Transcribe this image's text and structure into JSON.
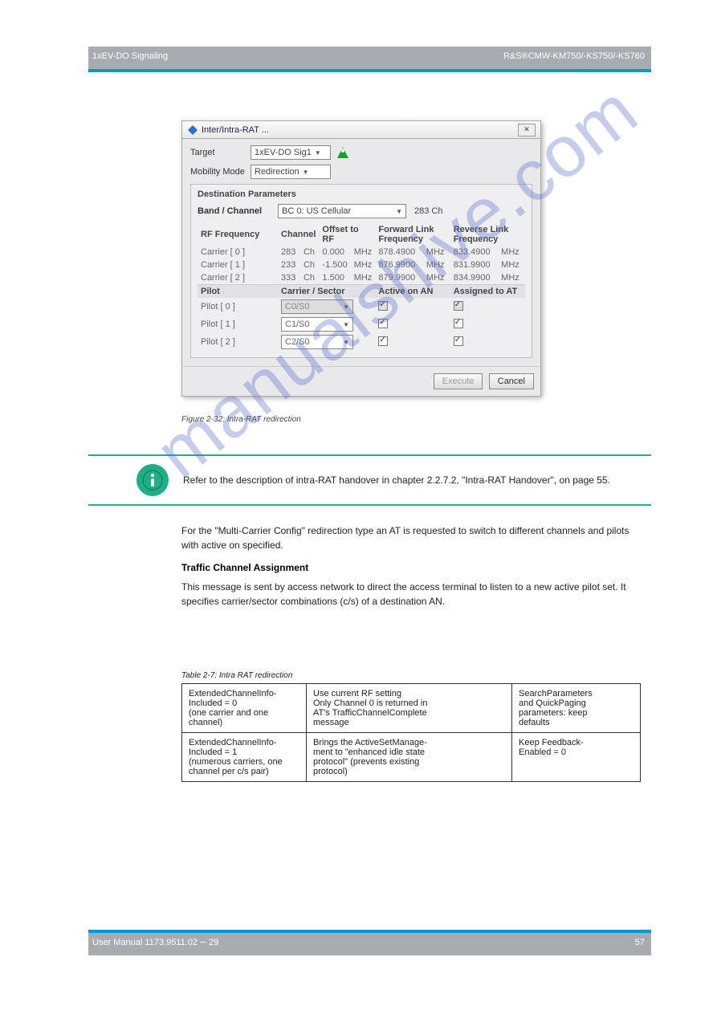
{
  "header": {
    "left": "1xEV-DO Signaling",
    "right": "R&S®CMW-KM750/-KS750/-KS760"
  },
  "dialog": {
    "title": "Inter/Intra-RAT ...",
    "target_label": "Target",
    "target_value": "1xEV-DO Sig1",
    "mobility_label": "Mobility Mode",
    "mobility_value": "Redirection",
    "group_title": "Destination Parameters",
    "band_label": "Band / Channel",
    "band_value": "BC 0: US Cellular",
    "band_ch": "283 Ch",
    "rf_label": "RF Frequency",
    "headers": {
      "ch": "Channel",
      "off": "Offset to RF",
      "fwd": "Forward Link Frequency",
      "rev": "Reverse Link Frequency"
    },
    "carriers": [
      {
        "name": "Carrier [ 0 ]",
        "ch": "283",
        "chu": "Ch",
        "off": "0.000",
        "offu": "MHz",
        "fwd": "878.4900",
        "fwdu": "MHz",
        "rev": "833.4900",
        "revu": "MHz"
      },
      {
        "name": "Carrier [ 1 ]",
        "ch": "233",
        "chu": "Ch",
        "off": "-1.500",
        "offu": "MHz",
        "fwd": "876.9900",
        "fwdu": "MHz",
        "rev": "831.9900",
        "revu": "MHz"
      },
      {
        "name": "Carrier [ 2 ]",
        "ch": "333",
        "chu": "Ch",
        "off": "1.500",
        "offu": "MHz",
        "fwd": "879.9900",
        "fwdu": "MHz",
        "rev": "834.9900",
        "revu": "MHz"
      }
    ],
    "pilot_label": "Pilot",
    "pilot_headers": {
      "cs": "Carrier / Sector",
      "act": "Active on AN",
      "asg": "Assigned to AT"
    },
    "pilots": [
      {
        "name": "Pilot [ 0 ]",
        "cs": "C0/S0"
      },
      {
        "name": "Pilot [ 1 ]",
        "cs": "C1/S0"
      },
      {
        "name": "Pilot [ 2 ]",
        "cs": "C2/S0"
      }
    ],
    "buttons": {
      "exec": "Execute",
      "cancel": "Cancel"
    }
  },
  "fig_caption": "Figure 2-32: Intra-RAT redirection",
  "callout": "Refer to the description of intra-RAT handover in chapter 2.2.7.2, \"Intra-RAT Handover\", on page 55.",
  "prose": {
    "p1": "For the \"Multi-Carrier Config\" redirection type an AT is requested to switch to different channels and pilots with active on specified.",
    "h1": "Traffic Channel Assignment",
    "p2": "This message is sent by access network to direct the access terminal to listen to a new active pilot set. It specifies carrier/sector combinations (c/s) of a destination AN."
  },
  "table": {
    "caption": "Table 2-7: Intra RAT redirection",
    "rows": [
      {
        "a_lines": [
          "ExtendedChannelInfo-",
          "Included = 0",
          "(one carrier and one",
          "channel)"
        ],
        "b_lines": [
          "Use current RF setting",
          "Only Channel 0 is returned in",
          "AT's TrafficChannelComplete",
          "message"
        ],
        "c_lines": [
          "SearchParameters",
          "and QuickPaging",
          "parameters: keep",
          "defaults"
        ]
      },
      {
        "a_lines": [
          "ExtendedChannelInfo-",
          "Included = 1",
          "(numerous carriers, one",
          "channel per c/s pair)"
        ],
        "b_lines": [
          "Brings the ActiveSetManage-",
          "ment to \"enhanced idle state",
          "protocol\" (prevents existing",
          "protocol)"
        ],
        "c_lines": [
          "Keep Feedback-",
          "Enabled = 0"
        ]
      }
    ]
  },
  "footer": {
    "left": "User Manual 1173.9511.02 ─ 29",
    "right": "57"
  },
  "watermark": "manualshive.com"
}
